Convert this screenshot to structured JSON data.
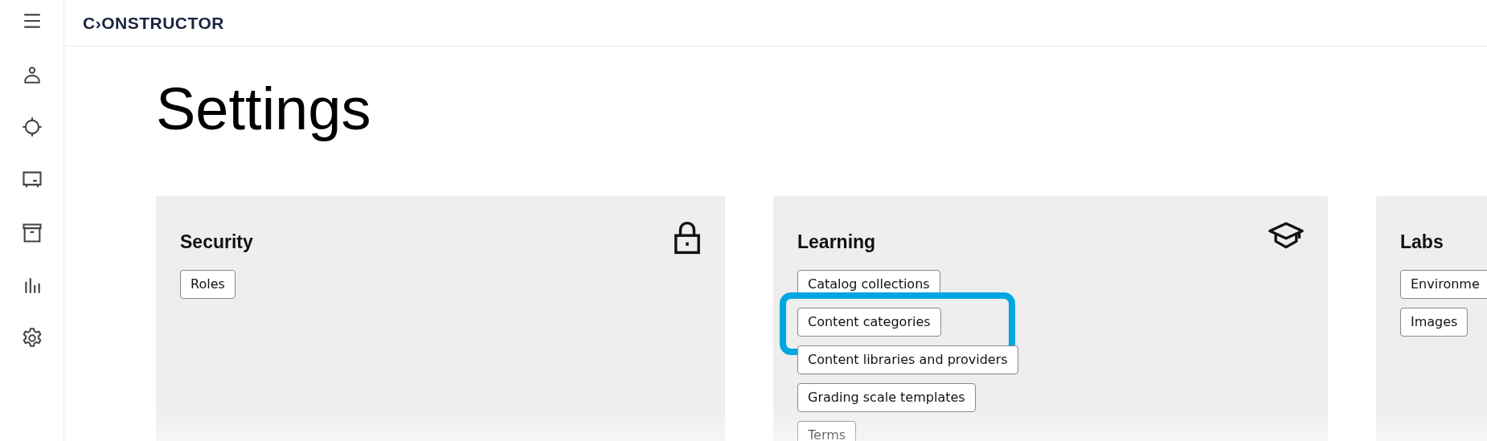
{
  "logo": "C›ONSTRUCTOR",
  "sidebar": {
    "items": [
      {
        "kind": "menu"
      },
      {
        "kind": "person"
      },
      {
        "kind": "target"
      },
      {
        "kind": "board"
      },
      {
        "kind": "archive"
      },
      {
        "kind": "chart"
      },
      {
        "kind": "gear"
      }
    ]
  },
  "page_title": "Settings",
  "cards": [
    {
      "title": "Security",
      "kind": "lock",
      "items": [
        {
          "label": "Roles",
          "highlighted": false
        }
      ]
    },
    {
      "title": "Learning",
      "kind": "cap",
      "items": [
        {
          "label": "Catalog collections",
          "highlighted": false
        },
        {
          "label": "Content categories",
          "highlighted": true
        },
        {
          "label": "Content libraries and providers",
          "highlighted": false
        },
        {
          "label": "Grading scale templates",
          "highlighted": false
        },
        {
          "label": "Terms",
          "highlighted": false
        }
      ]
    },
    {
      "title": "Labs",
      "kind": "plain",
      "items": [
        {
          "label": "Environme",
          "highlighted": false
        },
        {
          "label": "Images",
          "highlighted": false
        }
      ]
    }
  ]
}
